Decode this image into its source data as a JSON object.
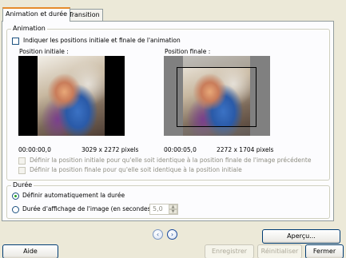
{
  "tabs": [
    {
      "label": "Animation et durée"
    },
    {
      "label": "Transition"
    }
  ],
  "animation": {
    "legend": "Animation",
    "show_positions_label": "Indiquer les positions initiale et finale de l'animation",
    "initial": {
      "title": "Position initiale :",
      "time": "00:00:00,0",
      "size": "3029 x 2272 pixels"
    },
    "final": {
      "title": "Position finale :",
      "time": "00:00:05,0",
      "size": "2272 x 1704 pixels"
    },
    "match_initial_label": "Définir la position initiale pour qu'elle soit identique à la position finale de l'image précédente",
    "match_final_label": "Définir la position finale pour qu'elle soit identique à la position initiale"
  },
  "duration": {
    "legend": "Durée",
    "auto_label": "Définir automatiquement la durée",
    "manual_label": "Durée d'affichage de l'image (en secondes)",
    "manual_value": "5,0"
  },
  "buttons": {
    "preview": "Aperçu...",
    "help": "Aide",
    "save": "Enregistrer",
    "reset": "Réinitialiser",
    "close": "Fermer"
  },
  "icons": {
    "prev": "previous-arrow-icon",
    "next": "next-arrow-icon"
  }
}
